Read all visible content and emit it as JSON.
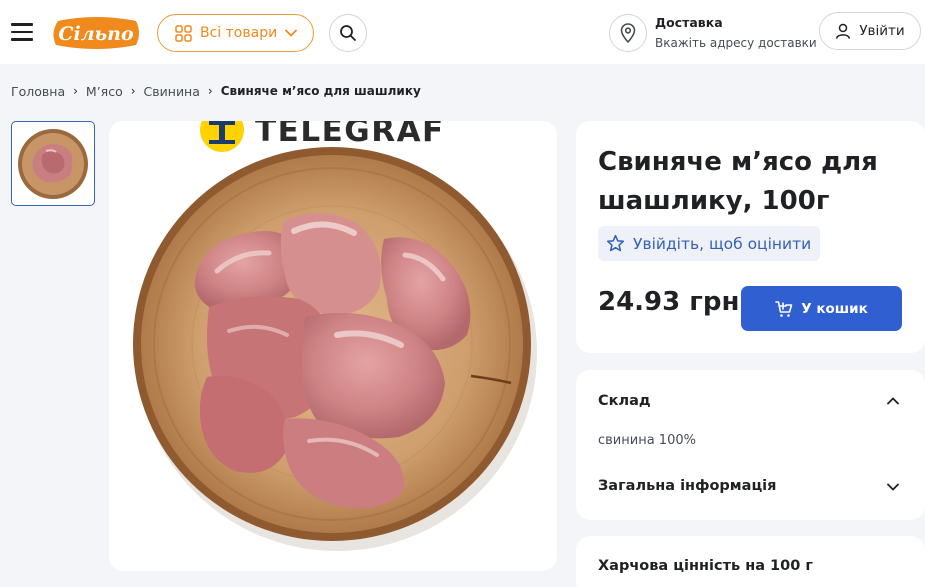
{
  "header": {
    "logo_text": "Сільпо",
    "catalog_label": "Всі товари",
    "delivery_title": "Доставка",
    "delivery_subtitle": "Вкажіть адресу доставки",
    "login_label": "Увійти",
    "colors": {
      "accent": "#f08a1c",
      "primary": "#2f5fd0"
    },
    "icons": [
      "menu-icon",
      "grid-icon",
      "chevron-down-icon",
      "search-icon",
      "location-pin-icon",
      "user-icon"
    ]
  },
  "breadcrumb": {
    "items": [
      "Головна",
      "М’ясо",
      "Свинина"
    ],
    "current": "Свиняче м’ясо для шашлику"
  },
  "gallery": {
    "watermark": "TELEGRAF"
  },
  "product": {
    "title": "Свиняче м’ясо для шашлику, 100г",
    "rate_label": "Увійдіть, щоб оцінити",
    "price": "24.93 грн",
    "cart_label": "У кошик"
  },
  "details": {
    "composition_title": "Склад",
    "composition_text": "свинина 100%",
    "general_title": "Загальна інформація",
    "nutrition_title": "Харчова цінність на 100 г"
  }
}
